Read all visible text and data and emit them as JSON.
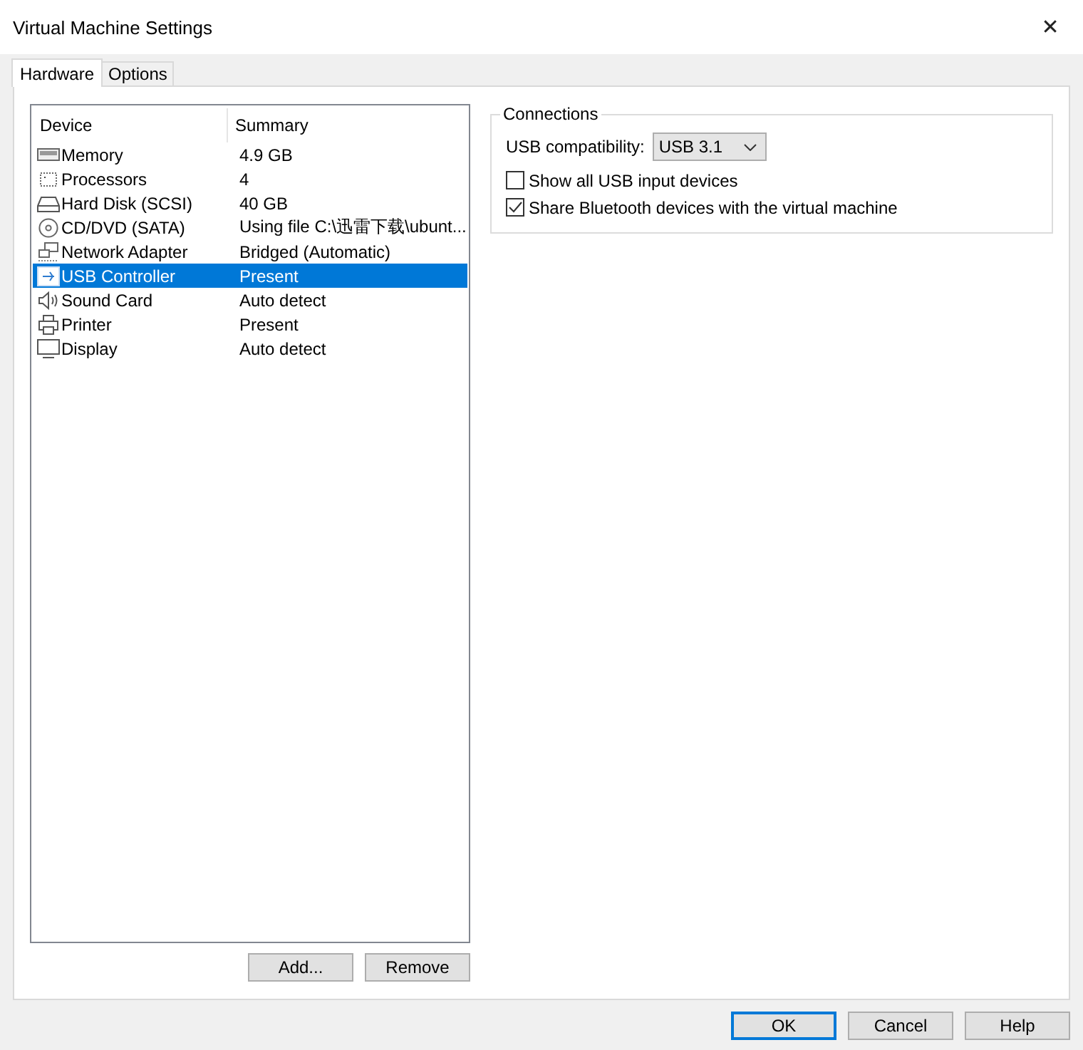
{
  "window": {
    "title": "Virtual Machine Settings",
    "close": "✕"
  },
  "tabs": [
    {
      "label": "Hardware",
      "selected": true
    },
    {
      "label": "Options",
      "selected": false
    }
  ],
  "device_list": {
    "columns": [
      "Device",
      "Summary"
    ],
    "rows": [
      {
        "kind": "memory",
        "device": "Memory",
        "summary": "4.9 GB",
        "selected": false
      },
      {
        "kind": "processor",
        "device": "Processors",
        "summary": "4",
        "selected": false
      },
      {
        "kind": "disk",
        "device": "Hard Disk (SCSI)",
        "summary": "40 GB",
        "selected": false
      },
      {
        "kind": "cd",
        "device": "CD/DVD (SATA)",
        "summary": "Using file C:\\迅雷下载\\ubunt...",
        "selected": false
      },
      {
        "kind": "network",
        "device": "Network Adapter",
        "summary": "Bridged (Automatic)",
        "selected": false
      },
      {
        "kind": "usb",
        "device": "USB Controller",
        "summary": "Present",
        "selected": true
      },
      {
        "kind": "sound",
        "device": "Sound Card",
        "summary": "Auto detect",
        "selected": false
      },
      {
        "kind": "printer",
        "device": "Printer",
        "summary": "Present",
        "selected": false
      },
      {
        "kind": "display",
        "device": "Display",
        "summary": "Auto detect",
        "selected": false
      }
    ],
    "buttons": [
      "Add...",
      "Remove"
    ]
  },
  "connections": {
    "title": "Connections",
    "compatibility_label": "USB compatibility:",
    "compatibility_value": "USB 3.1",
    "options": [
      {
        "label": "Show all USB input devices",
        "checked": false
      },
      {
        "label": "Share Bluetooth devices with the virtual machine",
        "checked": true
      }
    ]
  },
  "buttons": [
    {
      "label": "OK",
      "default": true
    },
    {
      "label": "Cancel",
      "default": false
    },
    {
      "label": "Help",
      "default": false
    }
  ]
}
